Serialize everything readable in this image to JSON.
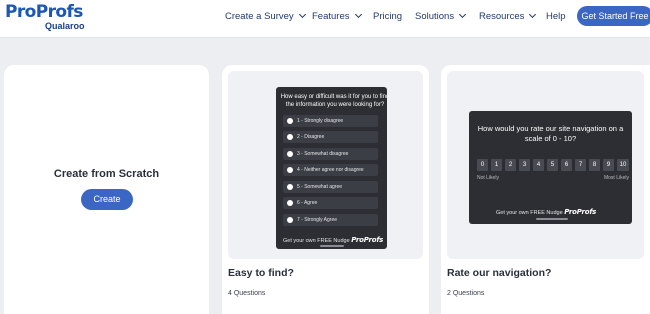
{
  "brand": {
    "logo_text": "ProProfs",
    "sub_text": "Qualaroo"
  },
  "nav": {
    "items": [
      {
        "label": "Create a Survey",
        "dropdown": true
      },
      {
        "label": "Features",
        "dropdown": true
      },
      {
        "label": "Pricing",
        "dropdown": false
      },
      {
        "label": "Solutions",
        "dropdown": true
      },
      {
        "label": "Resources",
        "dropdown": true
      },
      {
        "label": "Help",
        "dropdown": false
      }
    ],
    "cta_label": "Get Started Free"
  },
  "cards": {
    "scratch": {
      "title": "Create from Scratch",
      "button_label": "Create"
    },
    "easy": {
      "title": "Easy to find?",
      "count": "4 Questions",
      "preview": {
        "question": "How easy or difficult was it for you to find the information you were looking for?",
        "options": [
          "1 - Strongly disagree",
          "2 - Disagree",
          "3 - Somewhat disagree",
          "4 - Neither agree nor disagree",
          "5 - Somewhat agree",
          "6 - Agree",
          "7 - Strongly Agree"
        ],
        "footer_text": "Get your own FREE Nudge",
        "footer_brand": "ProProfs"
      }
    },
    "rate": {
      "title": "Rate our navigation?",
      "count": "2 Questions",
      "preview": {
        "question": "How would you rate our site navigation on a scale of 0 - 10?",
        "scale": [
          "0",
          "1",
          "2",
          "3",
          "4",
          "5",
          "6",
          "7",
          "8",
          "9",
          "10"
        ],
        "low_label": "Not Likely",
        "high_label": "Most Likely",
        "footer_text": "Get your own FREE Nudge",
        "footer_brand": "ProProfs"
      }
    }
  },
  "colors": {
    "accent": "#3c66c4",
    "brand_blue": "#1b56b8",
    "nudge_bg": "#2c2e33",
    "page_bg": "#eceef2"
  }
}
